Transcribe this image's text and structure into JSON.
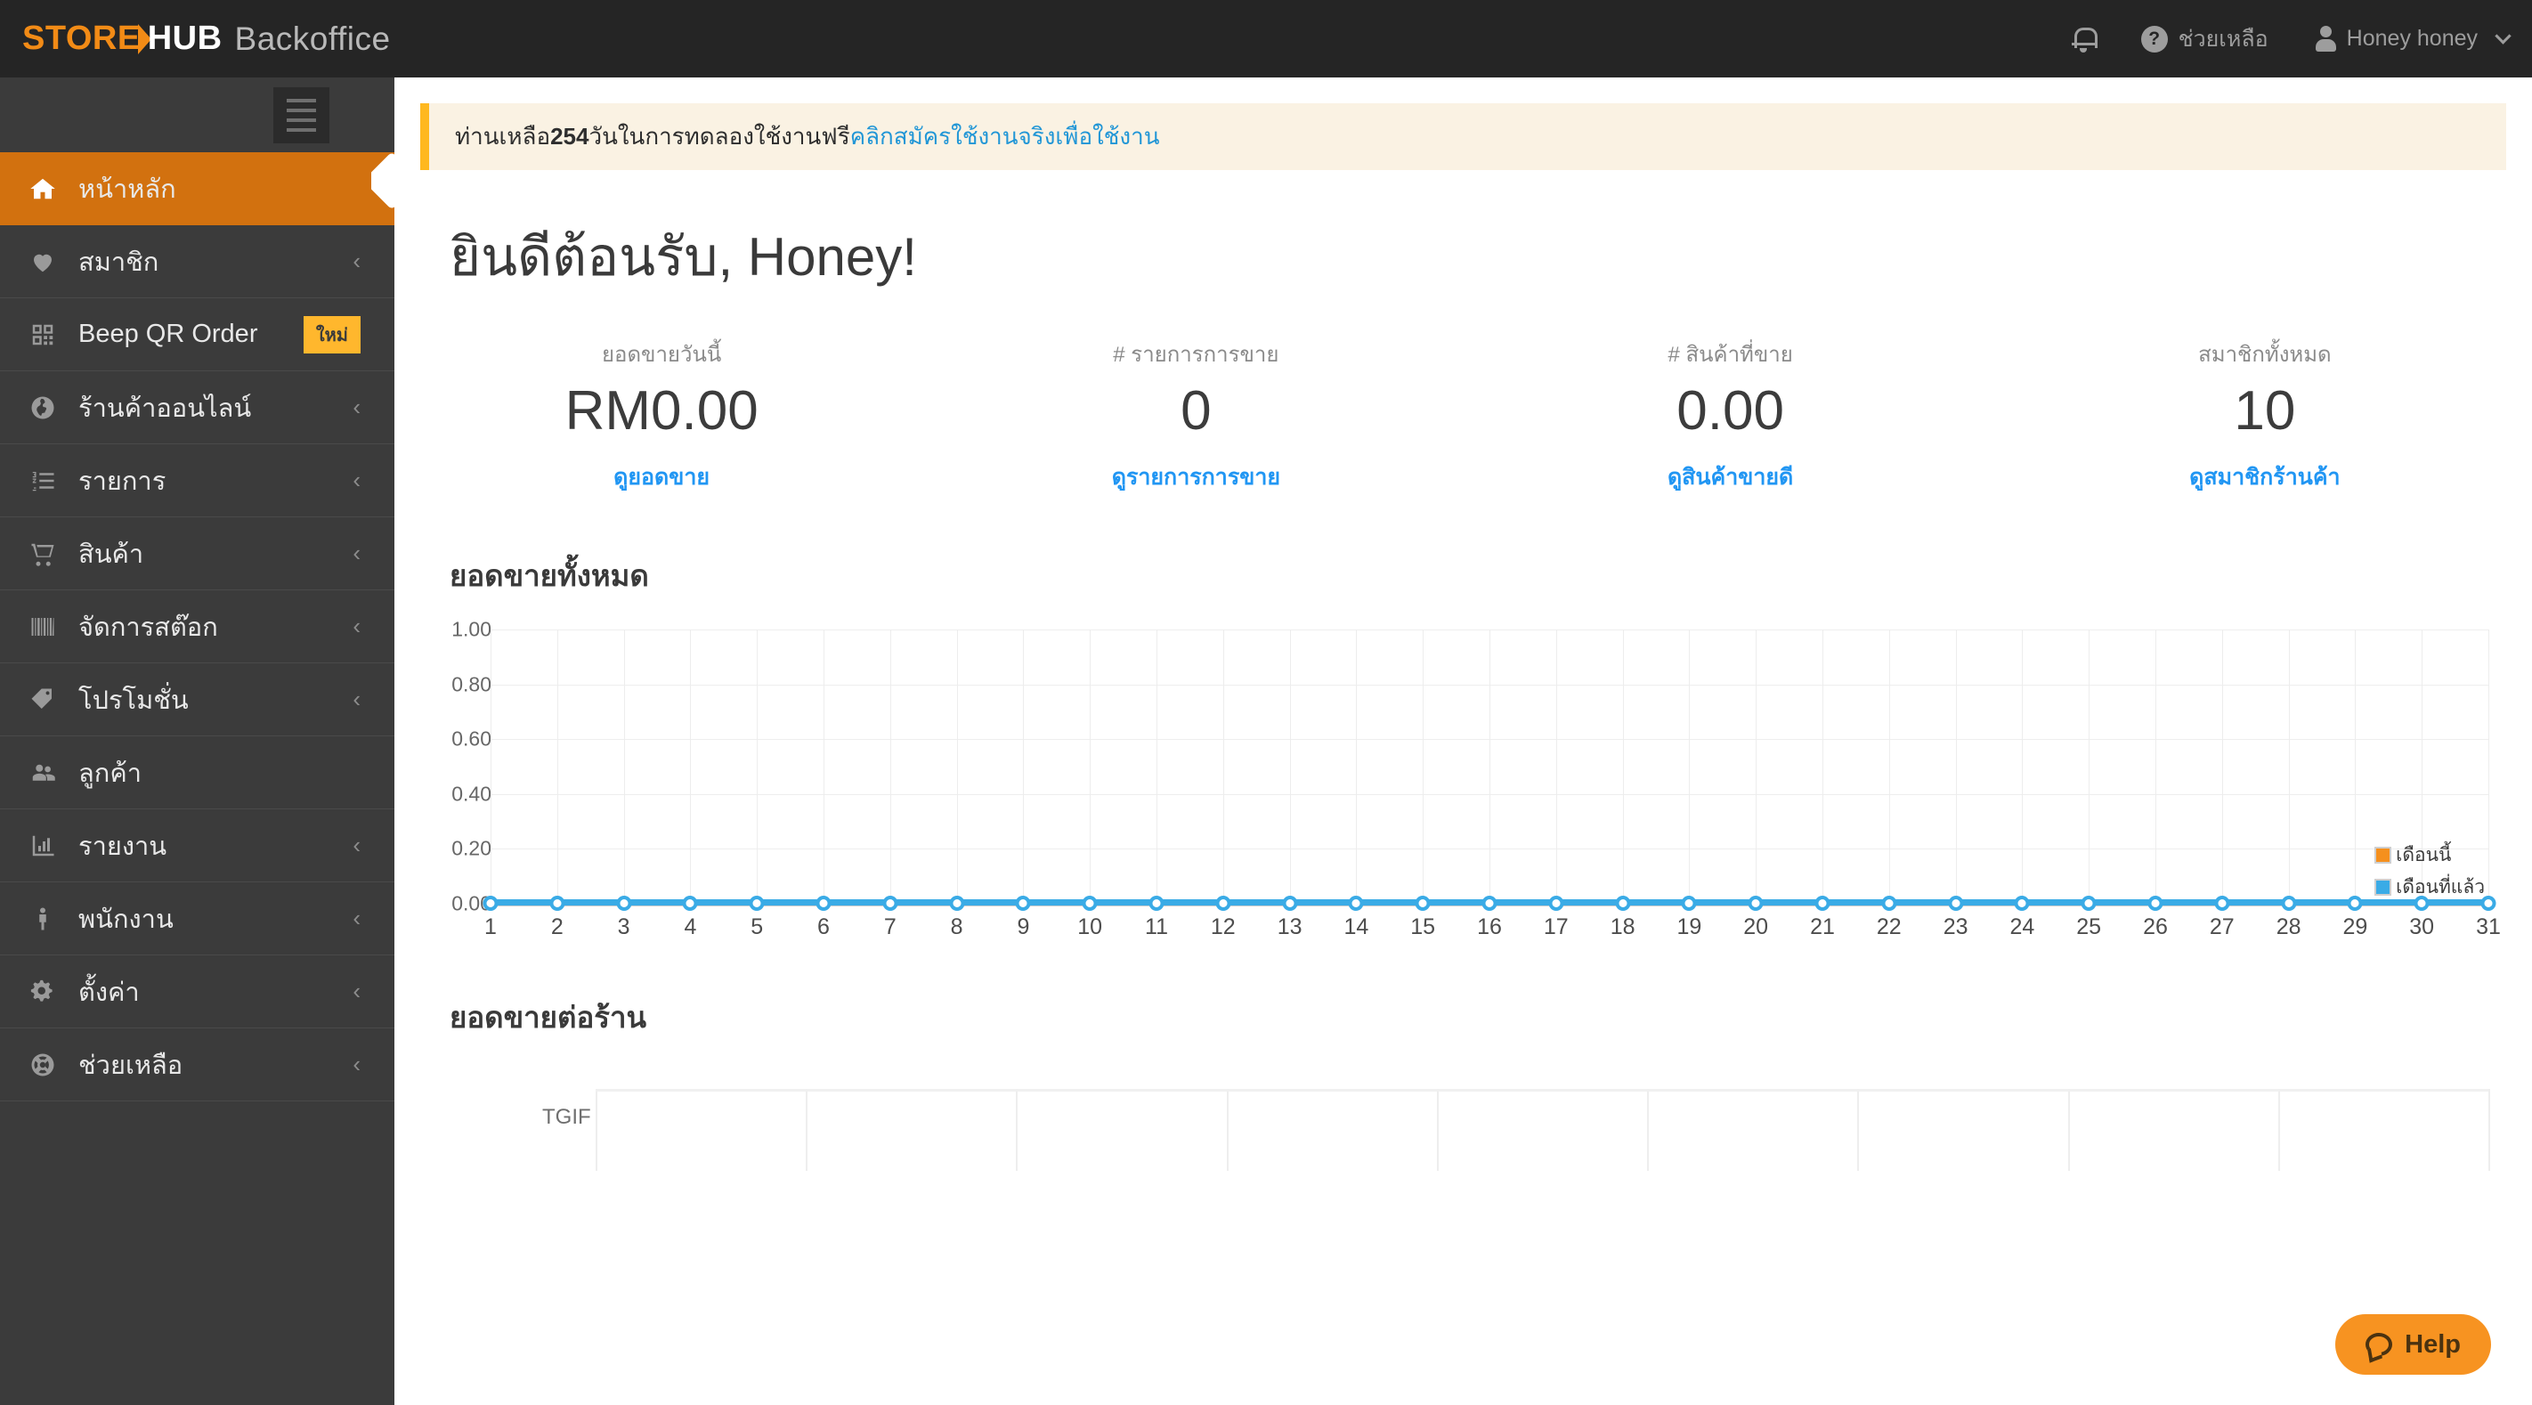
{
  "topbar": {
    "logo": {
      "store": "STORE",
      "hub": "HUB",
      "backoffice": "Backoffice"
    },
    "notifications_icon": "bell-icon",
    "help_label": "ช่วยเหลือ",
    "user_name": "Honey honey"
  },
  "sidebar": {
    "menu_toggle": "hamburger-icon",
    "items": [
      {
        "label": "หน้าหลัก",
        "icon": "home-icon",
        "active": true,
        "chevron": false,
        "badge": null
      },
      {
        "label": "สมาชิก",
        "icon": "heart-icon",
        "active": false,
        "chevron": true,
        "badge": null
      },
      {
        "label": "Beep QR Order",
        "icon": "qr-code-icon",
        "active": false,
        "chevron": false,
        "badge": "ใหม่"
      },
      {
        "label": "ร้านค้าออนไลน์",
        "icon": "globe-icon",
        "active": false,
        "chevron": true,
        "badge": null
      },
      {
        "label": "รายการ",
        "icon": "ordered-list-icon",
        "active": false,
        "chevron": true,
        "badge": null
      },
      {
        "label": "สินค้า",
        "icon": "cart-icon",
        "active": false,
        "chevron": true,
        "badge": null
      },
      {
        "label": "จัดการสต๊อก",
        "icon": "barcode-icon",
        "active": false,
        "chevron": true,
        "badge": null
      },
      {
        "label": "โปรโมชั่น",
        "icon": "tag-icon",
        "active": false,
        "chevron": true,
        "badge": null
      },
      {
        "label": "ลูกค้า",
        "icon": "users-icon",
        "active": false,
        "chevron": false,
        "badge": null
      },
      {
        "label": "รายงาน",
        "icon": "bar-chart-icon",
        "active": false,
        "chevron": true,
        "badge": null
      },
      {
        "label": "พนักงาน",
        "icon": "person-icon",
        "active": false,
        "chevron": true,
        "badge": null
      },
      {
        "label": "ตั้งค่า",
        "icon": "gears-icon",
        "active": false,
        "chevron": true,
        "badge": null
      },
      {
        "label": "ช่วยเหลือ",
        "icon": "lifebuoy-icon",
        "active": false,
        "chevron": true,
        "badge": null
      }
    ],
    "chevron_glyph": "‹"
  },
  "banner": {
    "text_before": "ท่านเหลือ ",
    "days": "254",
    "text_after": " วันในการทดลองใช้งานฟรี ",
    "link": "คลิกสมัครใช้งานจริงเพื่อใช้งาน"
  },
  "main": {
    "welcome": "ยินดีต้อนรับ, Honey!",
    "stats": [
      {
        "label": "ยอดขายวันนี้",
        "value": "RM0.00",
        "link": "ดูยอดขาย"
      },
      {
        "label": "# รายการการขาย",
        "value": "0",
        "link": "ดูรายการการขาย"
      },
      {
        "label": "# สินค้าที่ขาย",
        "value": "0.00",
        "link": "ดูสินค้าขายดี"
      },
      {
        "label": "สมาชิกทั้งหมด",
        "value": "10",
        "link": "ดูสมาชิกร้านค้า"
      }
    ],
    "section_sales_title": "ยอดขายทั้งหมด",
    "section_store_title": "ยอดขายต่อร้าน",
    "store_row_label": "TGIF"
  },
  "help_widget": {
    "label": "Help",
    "icon": "chat-bubble-icon"
  },
  "colors": {
    "brand_orange": "#F28B16",
    "sidebar_active": "#d2710f",
    "link_blue": "#2196f3",
    "series_blue": "#3aabe6",
    "legend_orange": "#F5901E",
    "badge_amber": "#FFB72D",
    "banner_bg": "#FAF2E3",
    "banner_border": "#FFB81F"
  },
  "chart_data": {
    "type": "line",
    "title": "ยอดขายทั้งหมด",
    "xlabel": "",
    "ylabel": "",
    "ylim": [
      0,
      1.0
    ],
    "yticks": [
      "0.00",
      "0.20",
      "0.40",
      "0.60",
      "0.80",
      "1.00"
    ],
    "ytick_values": [
      0,
      0.2,
      0.4,
      0.6,
      0.8,
      1.0
    ],
    "grid": true,
    "legend_position": "bottom-right",
    "categories": [
      1,
      2,
      3,
      4,
      5,
      6,
      7,
      8,
      9,
      10,
      11,
      12,
      13,
      14,
      15,
      16,
      17,
      18,
      19,
      20,
      21,
      22,
      23,
      24,
      25,
      26,
      27,
      28,
      29,
      30,
      31
    ],
    "series": [
      {
        "name": "เดือนนี้",
        "color": "#F5901E",
        "values": [
          0,
          0,
          0,
          0,
          0,
          0,
          0,
          0,
          0,
          0,
          0,
          0,
          0,
          0,
          0,
          0,
          0,
          0,
          0,
          0,
          0,
          0,
          0,
          0,
          0,
          0,
          0,
          0,
          0,
          0,
          0
        ]
      },
      {
        "name": "เดือนที่แล้ว",
        "color": "#3aabe6",
        "values": [
          0,
          0,
          0,
          0,
          0,
          0,
          0,
          0,
          0,
          0,
          0,
          0,
          0,
          0,
          0,
          0,
          0,
          0,
          0,
          0,
          0,
          0,
          0,
          0,
          0,
          0,
          0,
          0,
          0,
          0,
          0
        ]
      }
    ]
  }
}
